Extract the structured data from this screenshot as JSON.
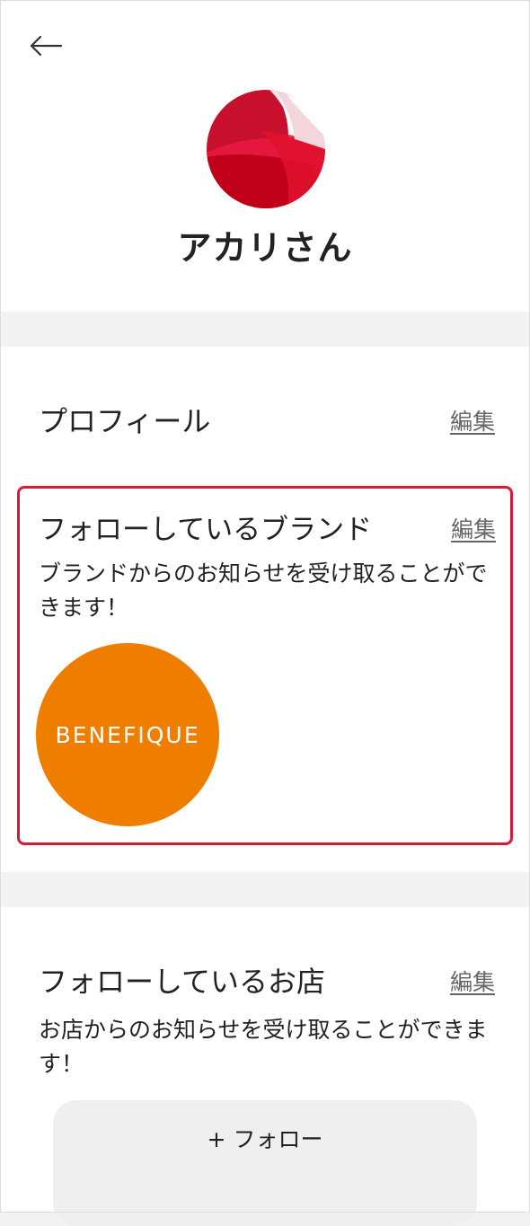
{
  "header": {
    "back_icon": "arrow-left-icon",
    "user_name": "アカリさん"
  },
  "profile": {
    "title": "プロフィール",
    "edit_label": "編集"
  },
  "followed_brands": {
    "title": "フォローしているブランド",
    "edit_label": "編集",
    "description": "ブランドからのお知らせを受け取ることができます！",
    "brands": [
      {
        "name": "BENEFIQUE",
        "color": "#ef7d00"
      }
    ]
  },
  "followed_stores": {
    "title": "フォローしているお店",
    "edit_label": "編集",
    "description": "お店からのお知らせを受け取ることができます！",
    "follow_button_label": "+ フォロー"
  },
  "colors": {
    "accent": "#d7193a",
    "brand_orange": "#ef7d00",
    "background": "#f3f3f3"
  }
}
